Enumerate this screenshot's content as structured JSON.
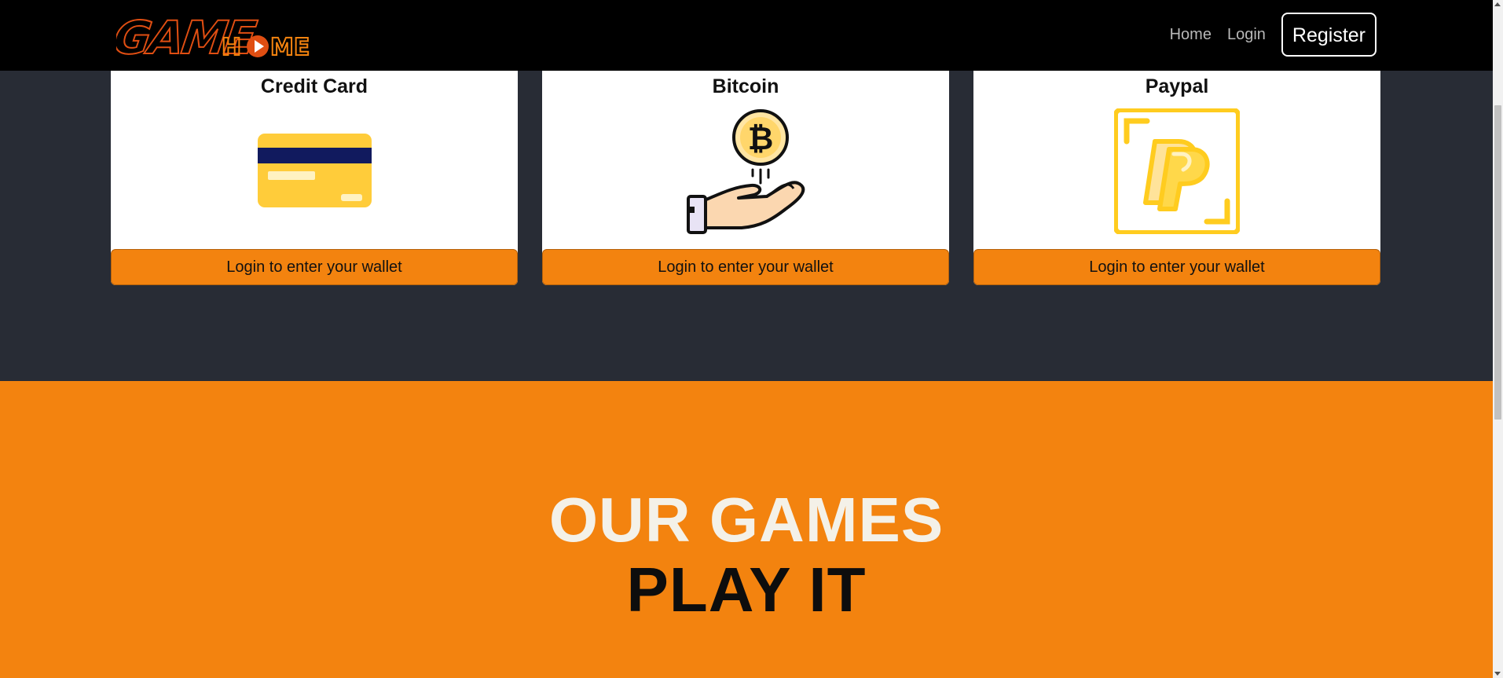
{
  "nav": {
    "logo": {
      "game_text": "GAME",
      "home_text": "HOME"
    },
    "links": [
      {
        "label": "Home"
      },
      {
        "label": "Login"
      }
    ],
    "register_label": "Register"
  },
  "wallets": [
    {
      "title": "Credit Card",
      "icon": "credit-card-icon",
      "button_label": "Login to enter your wallet"
    },
    {
      "title": "Bitcoin",
      "icon": "bitcoin-hand-icon",
      "button_label": "Login to enter your wallet"
    },
    {
      "title": "Paypal",
      "icon": "paypal-icon",
      "button_label": "Login to enter your wallet"
    }
  ],
  "games": {
    "title": "OUR GAMES",
    "subtitle": "PLAY IT"
  },
  "colors": {
    "accent_orange": "#f3830f",
    "dark_background": "#282c35",
    "navbar_background": "#000000",
    "card_yellow": "#ffcc3a",
    "card_stripe": "#111a5e"
  }
}
